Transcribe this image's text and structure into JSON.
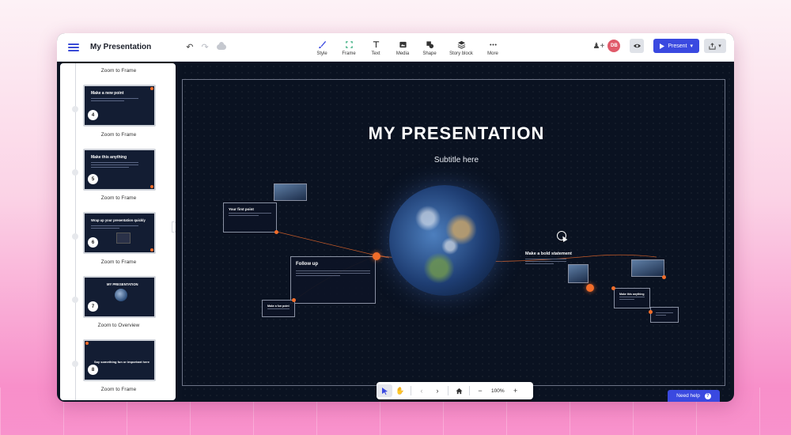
{
  "app": {
    "title": "My Presentation"
  },
  "toolbar": {
    "tools": [
      {
        "label": "Style",
        "icon": "brush-icon"
      },
      {
        "label": "Frame",
        "icon": "frame-icon"
      },
      {
        "label": "Text",
        "icon": "text-icon"
      },
      {
        "label": "Media",
        "icon": "media-icon"
      },
      {
        "label": "Shape",
        "icon": "shape-icon"
      },
      {
        "label": "Story block",
        "icon": "story-block-icon"
      },
      {
        "label": "More",
        "icon": "more-icon"
      }
    ],
    "avatar_initials": "DB",
    "present_label": "Present"
  },
  "sidebar": {
    "captions": [
      "Zoom to Frame",
      "Zoom to Frame",
      "Zoom to Frame",
      "Zoom to Frame",
      "Zoom to Overview",
      "Zoom to Frame"
    ],
    "slides": [
      {
        "number": "4",
        "title": "Make a new point"
      },
      {
        "number": "5",
        "title": "Make this anything"
      },
      {
        "number": "6",
        "title": "Wrap up your presentation quickly"
      },
      {
        "number": "7",
        "title": "MY PRESENTATION"
      },
      {
        "number": "8",
        "title": "Say something fun or important here"
      }
    ]
  },
  "canvas": {
    "title": "MY PRESENTATION",
    "subtitle": "Subtitle here",
    "cards": {
      "first_point": "Your first point",
      "follow_up": "Follow up",
      "small_left": "Make a fun point",
      "bold_statement": "Make a bold statement",
      "right_card": "Make this anything"
    }
  },
  "bottombar": {
    "zoom": "100%"
  },
  "help": {
    "label": "Need help",
    "icon_text": "?"
  },
  "colors": {
    "accent": "#3a49e0",
    "orange": "#f26d2a",
    "canvas_bg": "#0a1221"
  }
}
